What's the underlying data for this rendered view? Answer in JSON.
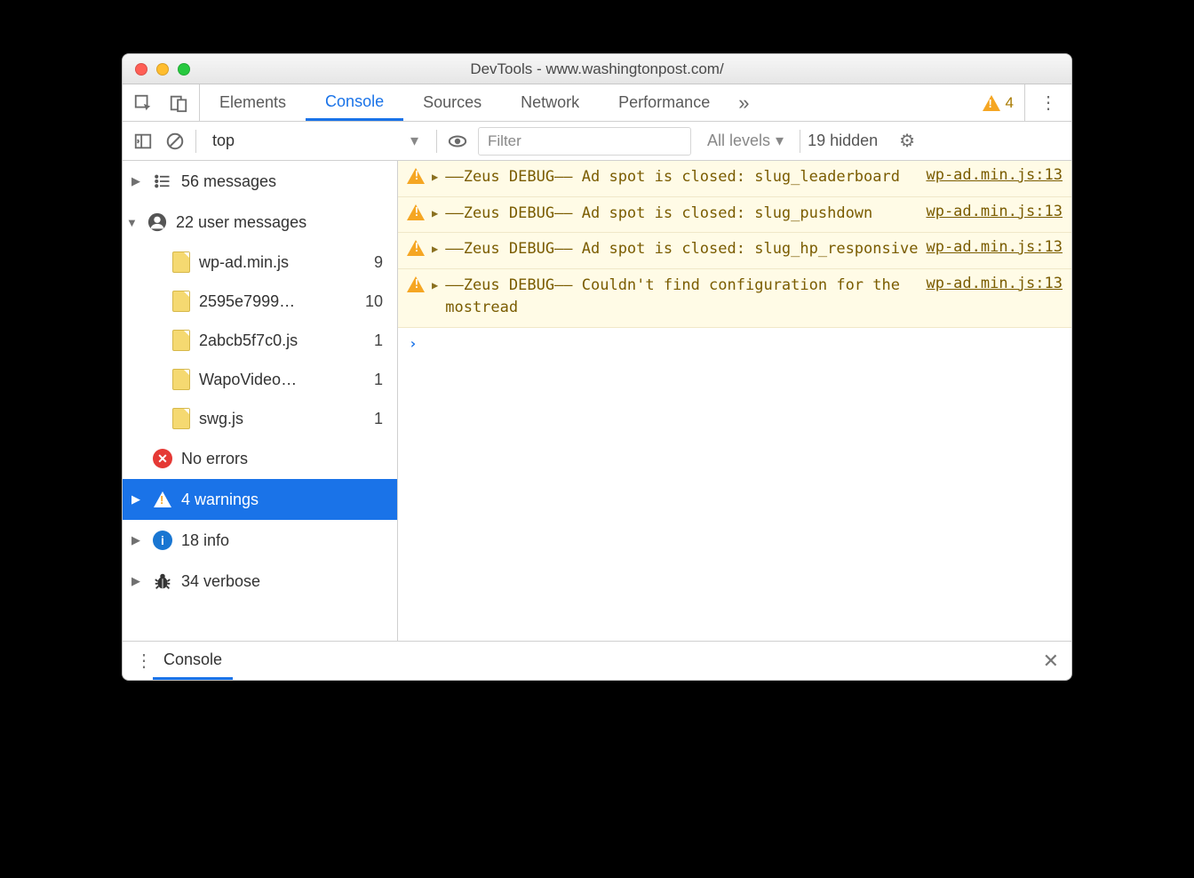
{
  "window": {
    "title": "DevTools - www.washingtonpost.com/"
  },
  "tabs": {
    "items": [
      "Elements",
      "Console",
      "Sources",
      "Network",
      "Performance"
    ],
    "active": "Console",
    "overflow_glyph": "»",
    "warn_count": "4"
  },
  "toolbar": {
    "context": "top",
    "filter_placeholder": "Filter",
    "levels": "All levels",
    "hidden": "19 hidden"
  },
  "sidebar": {
    "messages_count": "56 messages",
    "user_messages": "22 user messages",
    "files": [
      {
        "name": "wp-ad.min.js",
        "count": "9"
      },
      {
        "name": "2595e7999…",
        "count": "10"
      },
      {
        "name": "2abcb5f7c0.js",
        "count": "1"
      },
      {
        "name": "WapoVideo…",
        "count": "1"
      },
      {
        "name": "swg.js",
        "count": "1"
      }
    ],
    "no_errors": "No errors",
    "warnings": "4 warnings",
    "info": "18 info",
    "verbose": "34 verbose"
  },
  "messages": [
    {
      "text": "––Zeus DEBUG–– Ad spot is closed: slug_leaderboard",
      "src": "wp-ad.min.js:13"
    },
    {
      "text": "––Zeus DEBUG–– Ad spot is closed: slug_pushdown",
      "src": "wp-ad.min.js:13"
    },
    {
      "text": "––Zeus DEBUG–– Ad spot is closed: slug_hp_responsive",
      "src": "wp-ad.min.js:13"
    },
    {
      "text": "––Zeus DEBUG–– Couldn't find configuration for the mostread",
      "src": "wp-ad.min.js:13"
    }
  ],
  "drawer": {
    "tab": "Console"
  },
  "prompt": "›"
}
